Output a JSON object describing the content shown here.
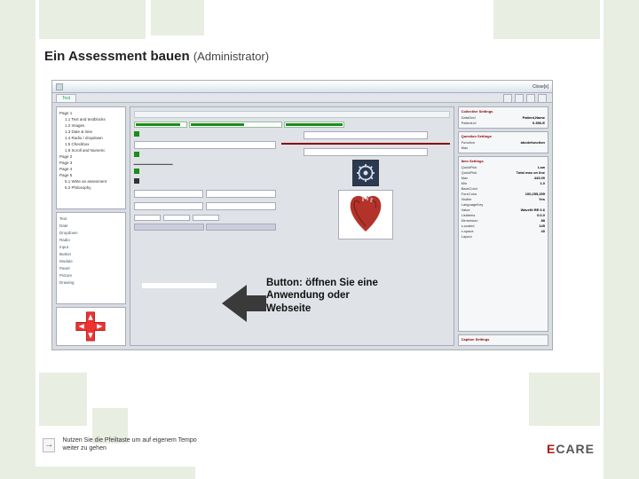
{
  "title": "Ein Assessment bauen",
  "subtitle": "(Administrator)",
  "window": {
    "tab": "Test",
    "close": "Close[x]",
    "tree": [
      "Page 1",
      " 1.1 Text and textblocks",
      " 1.2 Images",
      " 1.3 Date & time",
      " 1.4 Radio / dropdown",
      " 1.5 Checkbox",
      " 1.6 Scroll and Numeric",
      "Page 2",
      "Page 3",
      "Page 4",
      "Page 5",
      " 5.1 Write an assesment",
      " 5.2 Philosophy"
    ],
    "palette": [
      "Text",
      "Date",
      "Dropdown",
      "Radio",
      "Input",
      "Button",
      "Module",
      "Panel",
      "Picture",
      "Drawing"
    ],
    "sections": {
      "collective": "Collective Settings",
      "question": "Question Settings",
      "item": "Item Settings",
      "caption": "Caption Settings"
    },
    "props": [
      [
        "DataGrid",
        "Patient,Name"
      ],
      [
        "Patient-id",
        "0.356-E"
      ],
      [
        "Function",
        "abcdefunction"
      ],
      [
        "Max",
        ""
      ],
      [
        "QuickPick",
        "Low"
      ],
      [
        "QuickPick",
        "Total max on line"
      ],
      [
        "Max",
        "443.00"
      ],
      [
        "Min",
        "1.0"
      ],
      [
        "BackColor",
        ""
      ],
      [
        "ForeColor",
        "100,255,255"
      ],
      [
        "Visible",
        "Yes"
      ],
      [
        "LanguageKey",
        ""
      ],
      [
        "Value",
        "Wavefit RE 6.6"
      ],
      [
        "Listitems",
        "0.0.0"
      ],
      [
        "Dimension",
        "88"
      ],
      [
        "x-scaled",
        "145"
      ],
      [
        "x-space",
        "40"
      ],
      [
        "Layout",
        ""
      ]
    ]
  },
  "annotation": "Button: öffnen Sie eine Anwendung oder Webseite",
  "hint": "Nutzen Sie die Pfeiltaste um auf eigenem Tempo weiter zu gehen",
  "logo": {
    "e": "E",
    "rest": "CARE"
  }
}
